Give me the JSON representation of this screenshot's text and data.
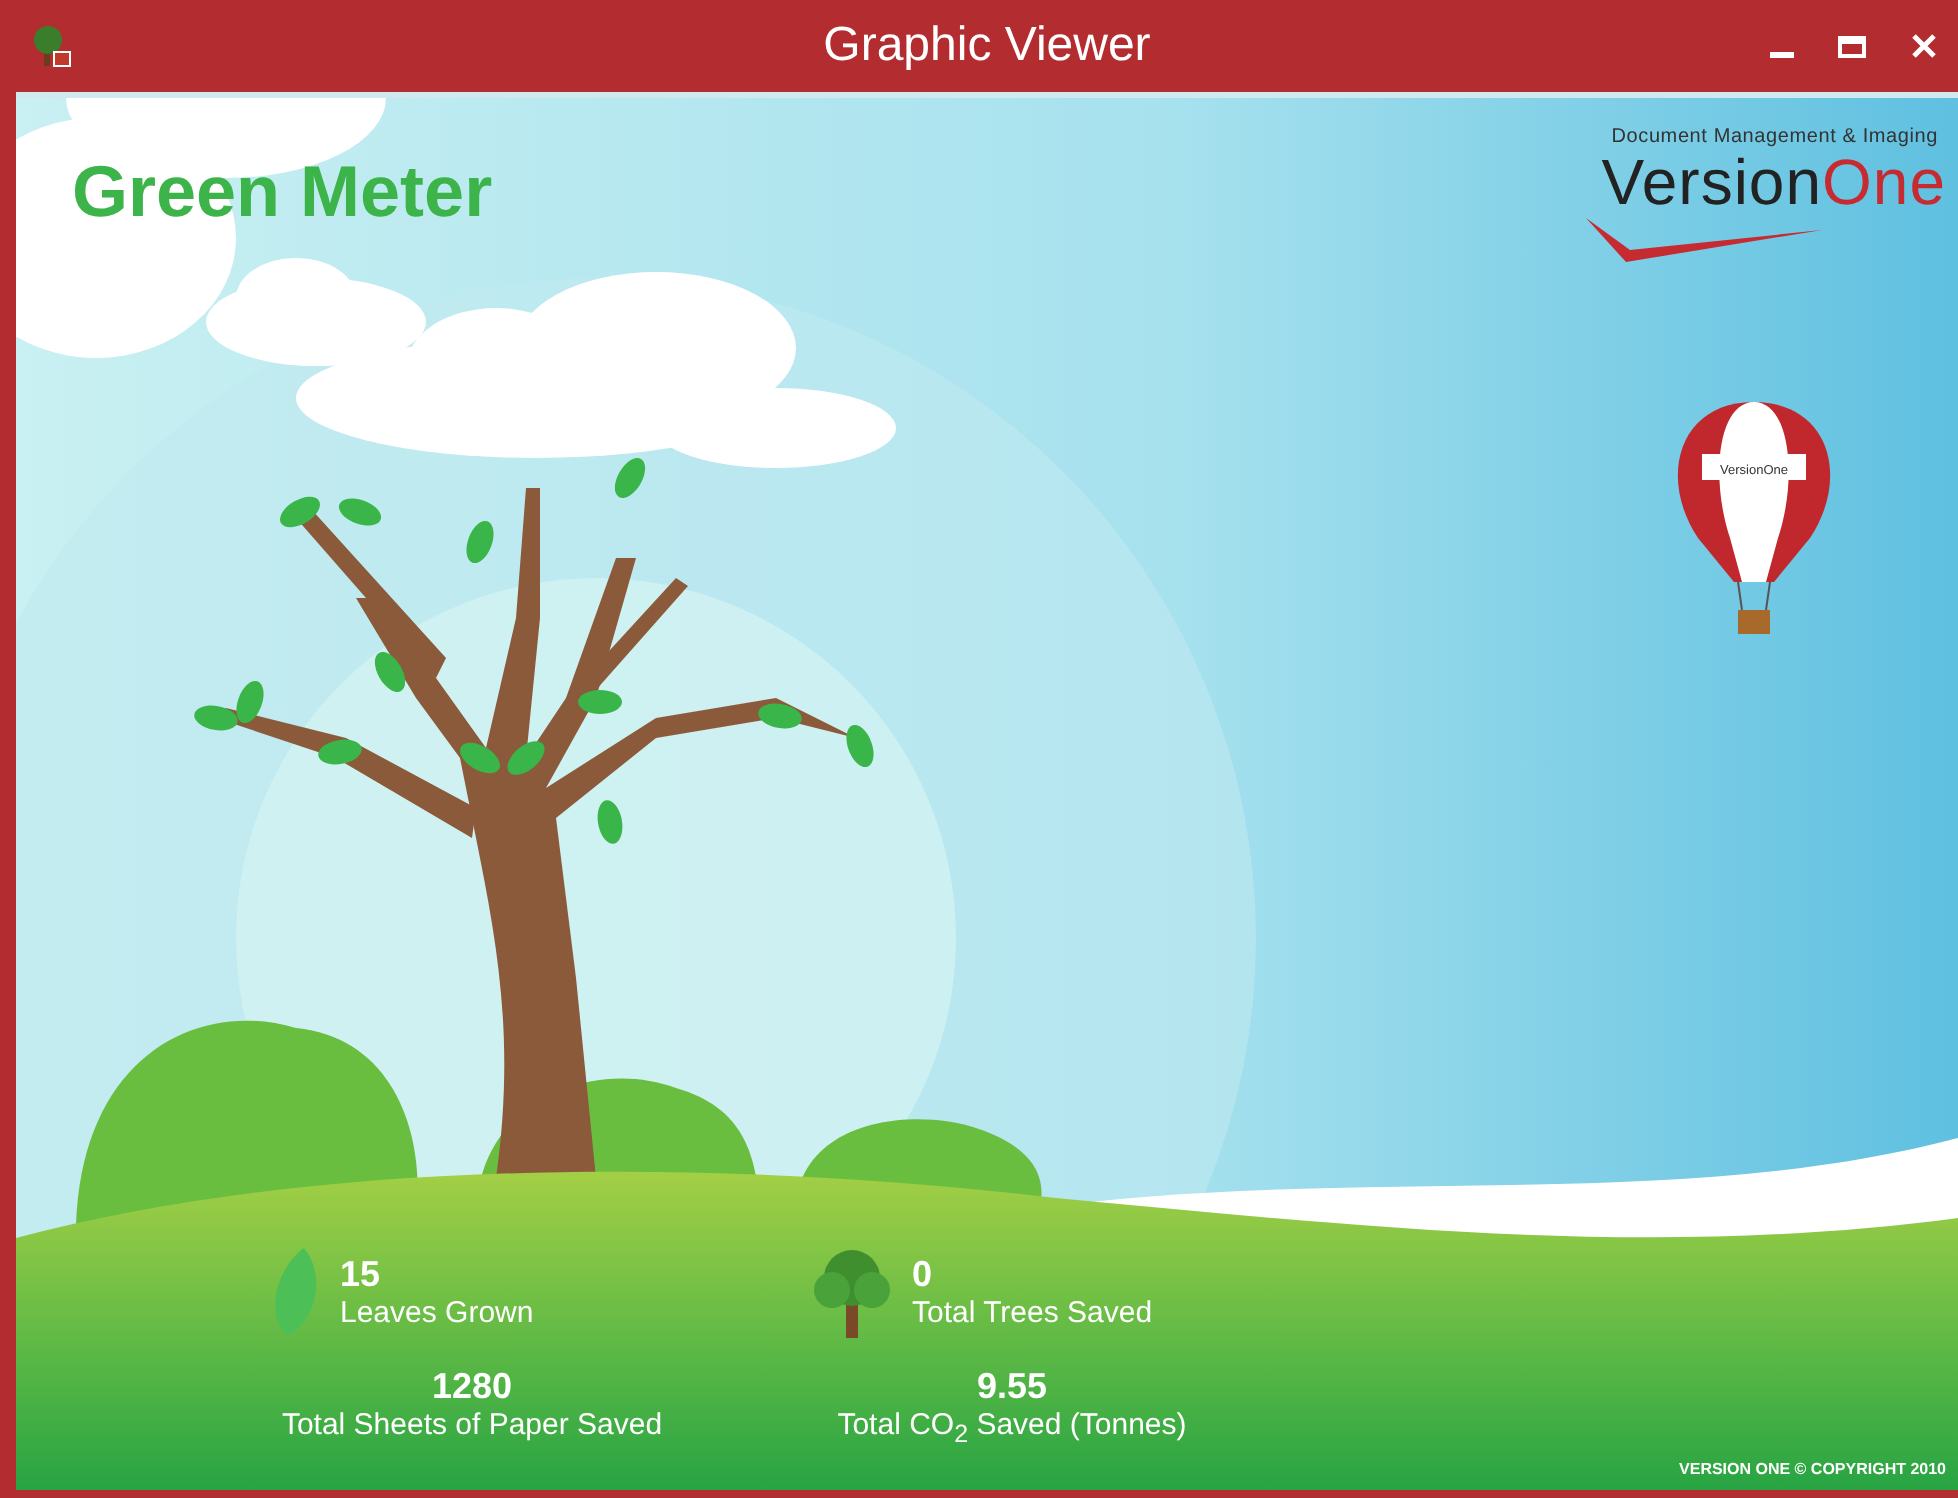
{
  "window": {
    "title": "Graphic Viewer"
  },
  "app_title": "Green Meter",
  "logo": {
    "tagline": "Document Management & Imaging",
    "name_first": "Version",
    "name_second": "One"
  },
  "balloon": {
    "label": "VersionOne"
  },
  "stats": [
    {
      "kind": "leaf",
      "value": "15",
      "label": "Leaves Grown"
    },
    {
      "kind": "tree",
      "value": "0",
      "label": "Total Trees Saved"
    },
    {
      "kind": "plain",
      "value": "1280",
      "label": "Total Sheets of Paper Saved"
    },
    {
      "kind": "plain",
      "value": "9.55",
      "label": "Total CO$_{2}$ Saved (Tonnes)"
    }
  ],
  "footer": {
    "copyright": "VERSION ONE © COPYRIGHT 2010"
  }
}
